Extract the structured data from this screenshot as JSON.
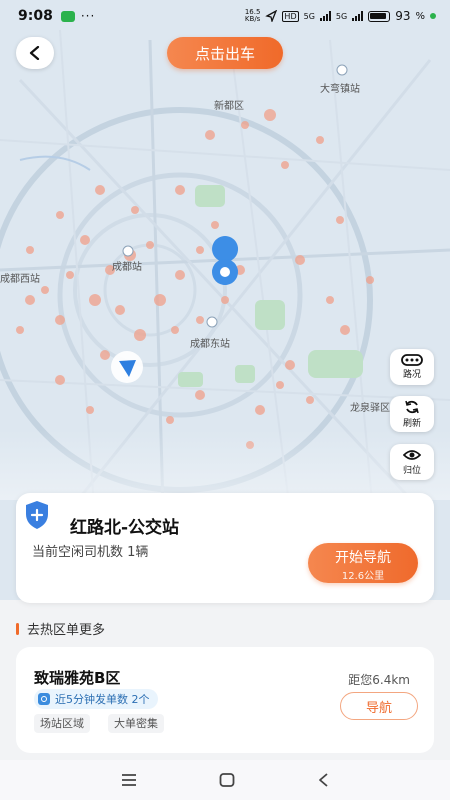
{
  "status_bar": {
    "time": "9:08",
    "network_speed": "16.5\nKB/s",
    "hd_label": "HD",
    "sig1": "5G",
    "sig2": "5G",
    "battery": "93"
  },
  "map": {
    "labels": {
      "xindu": "新都区",
      "dawan": "大弯镇站",
      "chengdu_station": "成都站",
      "chengdu_west": "成都西站",
      "chengdu_east": "成都东站",
      "longquanyi": "龙泉驿区"
    }
  },
  "header": {
    "depart_label": "点击出车"
  },
  "tools": [
    {
      "label": "路况",
      "icon": "traffic-icon"
    },
    {
      "label": "刷新",
      "icon": "refresh-icon"
    },
    {
      "label": "归位",
      "icon": "locate-icon"
    }
  ],
  "station": {
    "name": "红路北-公交站",
    "idle_drivers": "当前空闲司机数 1辆",
    "nav_label": "开始导航",
    "distance": "12.6公里"
  },
  "section": {
    "title": "去热区单更多"
  },
  "hot_zone": {
    "name": "致瑞雅苑B区",
    "distance": "距您6.4km",
    "badge": "近5分钟发单数 2个",
    "tags": [
      "场站区域",
      "大单密集"
    ],
    "nav_label": "导航"
  },
  "colors": {
    "accent": "#f06a2a",
    "link": "#2c6fb3"
  }
}
